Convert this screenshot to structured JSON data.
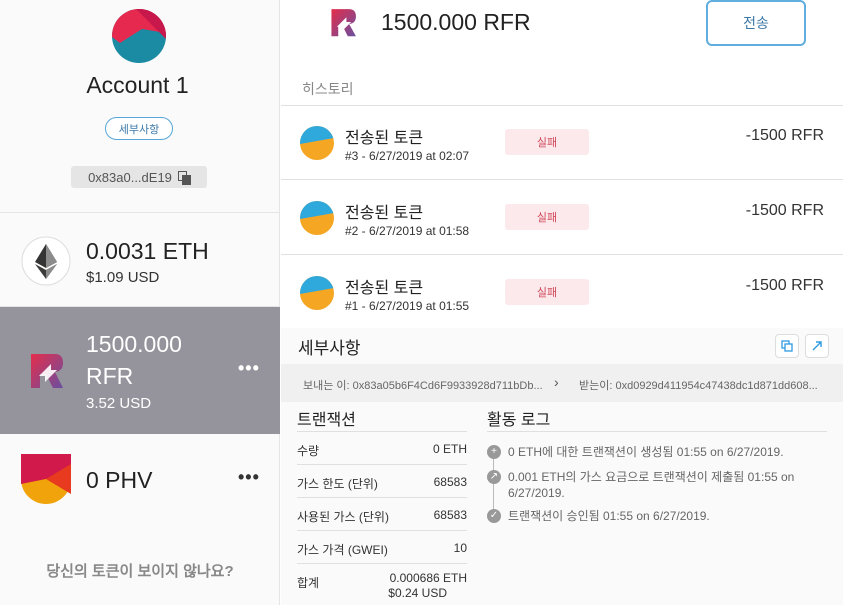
{
  "account": {
    "name": "Account 1",
    "details_label": "세부사항",
    "address": "0x83a0...dE19"
  },
  "tokens": [
    {
      "amount": "0.0031 ETH",
      "usd": "$1.09 USD",
      "icon": "ethereum-icon"
    },
    {
      "amount_line1": "1500.000",
      "amount_line2": "RFR",
      "usd": "3.52 USD",
      "icon": "refereum-icon"
    },
    {
      "amount": "0 PHV",
      "icon": "phv-token-icon"
    }
  ],
  "missing_tokens_text": "당신의 토큰이 보이지 않나요?",
  "header": {
    "amount": "1500.000 RFR",
    "send_label": "전송"
  },
  "history": {
    "label": "히스토리",
    "items": [
      {
        "title": "전송된 토큰",
        "sub": "#3 - 6/27/2019 at 02:07",
        "status": "실패",
        "amount": "-1500 RFR"
      },
      {
        "title": "전송된 토큰",
        "sub": "#2 - 6/27/2019 at 01:58",
        "status": "실패",
        "amount": "-1500 RFR"
      },
      {
        "title": "전송된 토큰",
        "sub": "#1 - 6/27/2019 at 01:55",
        "status": "실패",
        "amount": "-1500 RFR"
      }
    ]
  },
  "details": {
    "heading": "세부사항",
    "from": "보내는 이: 0x83a05b6F4Cd6F9933928d711bDb...",
    "to": "받는이: 0xd0929d411954c47438dc1d871dd608...",
    "transaction": {
      "title": "트랜잭션",
      "rows": [
        {
          "k": "수량",
          "v": "0 ETH"
        },
        {
          "k": "가스 한도 (단위)",
          "v": "68583"
        },
        {
          "k": "사용된 가스 (단위)",
          "v": "68583"
        },
        {
          "k": "가스 가격 (GWEI)",
          "v": "10"
        }
      ],
      "total_label": "합계",
      "total_eth": "0.000686 ETH",
      "total_usd": "$0.24 USD"
    },
    "activity": {
      "title": "활동 로그",
      "items": [
        {
          "text": "0 ETH에 대한 트랜잭션이 생성됨 01:55 on 6/27/2019.",
          "icon": "plus-icon"
        },
        {
          "text": "0.001 ETH의 가스 요금으로 트랜잭션이 제출됨 01:55 on 6/27/2019.",
          "icon": "arrow-up-right-icon"
        },
        {
          "text": "트랜잭션이 승인됨 01:55 on 6/27/2019.",
          "icon": "check-icon"
        }
      ]
    }
  },
  "colors": {
    "accent_blue": "#5faedf",
    "active_row": "#95949c",
    "failed_bg": "#fbe9ec",
    "failed_text": "#d14858"
  }
}
